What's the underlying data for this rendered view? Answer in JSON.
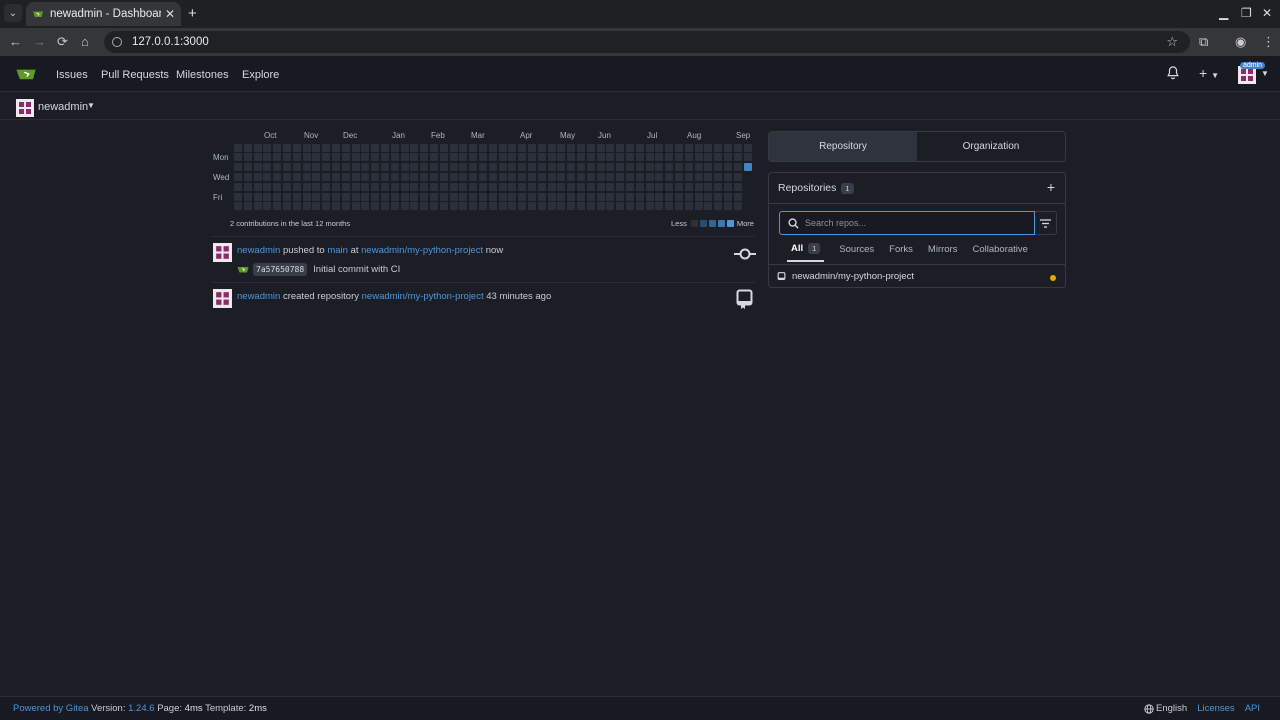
{
  "browser": {
    "tab_title": "newadmin - Dashboard",
    "url": "127.0.0.1:3000"
  },
  "nav": {
    "items": [
      "Issues",
      "Pull Requests",
      "Milestones",
      "Explore"
    ],
    "admin_badge": "admin"
  },
  "context": {
    "user": "newadmin"
  },
  "heatmap": {
    "months": [
      "Oct",
      "Nov",
      "Dec",
      "Jan",
      "Feb",
      "Mar",
      "Apr",
      "May",
      "Jun",
      "Jul",
      "Aug",
      "Sep"
    ],
    "days": [
      "Mon",
      "Wed",
      "Fri"
    ],
    "summary": "2 contributions in the last 12 months",
    "legend_less": "Less",
    "legend_more": "More",
    "active_color": "#4183c4",
    "empty_color": "#2c303a"
  },
  "feed": [
    {
      "user": "newadmin",
      "action": "pushed to",
      "branch": "main",
      "at": "at",
      "repo": "newadmin/my-python-project",
      "time": "now",
      "sha": "7a57650788",
      "message": "Initial commit with CI",
      "icon": "git-commit-icon"
    },
    {
      "user": "newadmin",
      "action": "created repository",
      "repo": "newadmin/my-python-project",
      "time": "43 minutes ago",
      "icon": "repo-icon"
    }
  ],
  "panel": {
    "seg_repo": "Repository",
    "seg_org": "Organization",
    "title": "Repositories",
    "count": "1",
    "search_placeholder": "Search repos...",
    "tabs": [
      "All",
      "Sources",
      "Forks",
      "Mirrors",
      "Collaborative"
    ],
    "all_count": "1",
    "repo": "newadmin/my-python-project",
    "status_color": "#e8a600"
  },
  "footer": {
    "powered": "Powered by Gitea",
    "version_label": "Version:",
    "version": "1.24.6",
    "page_label": "Page:",
    "page_time": "4ms",
    "template_label": "Template:",
    "template_time": "2ms",
    "language": "English",
    "licenses": "Licenses",
    "api": "API"
  }
}
